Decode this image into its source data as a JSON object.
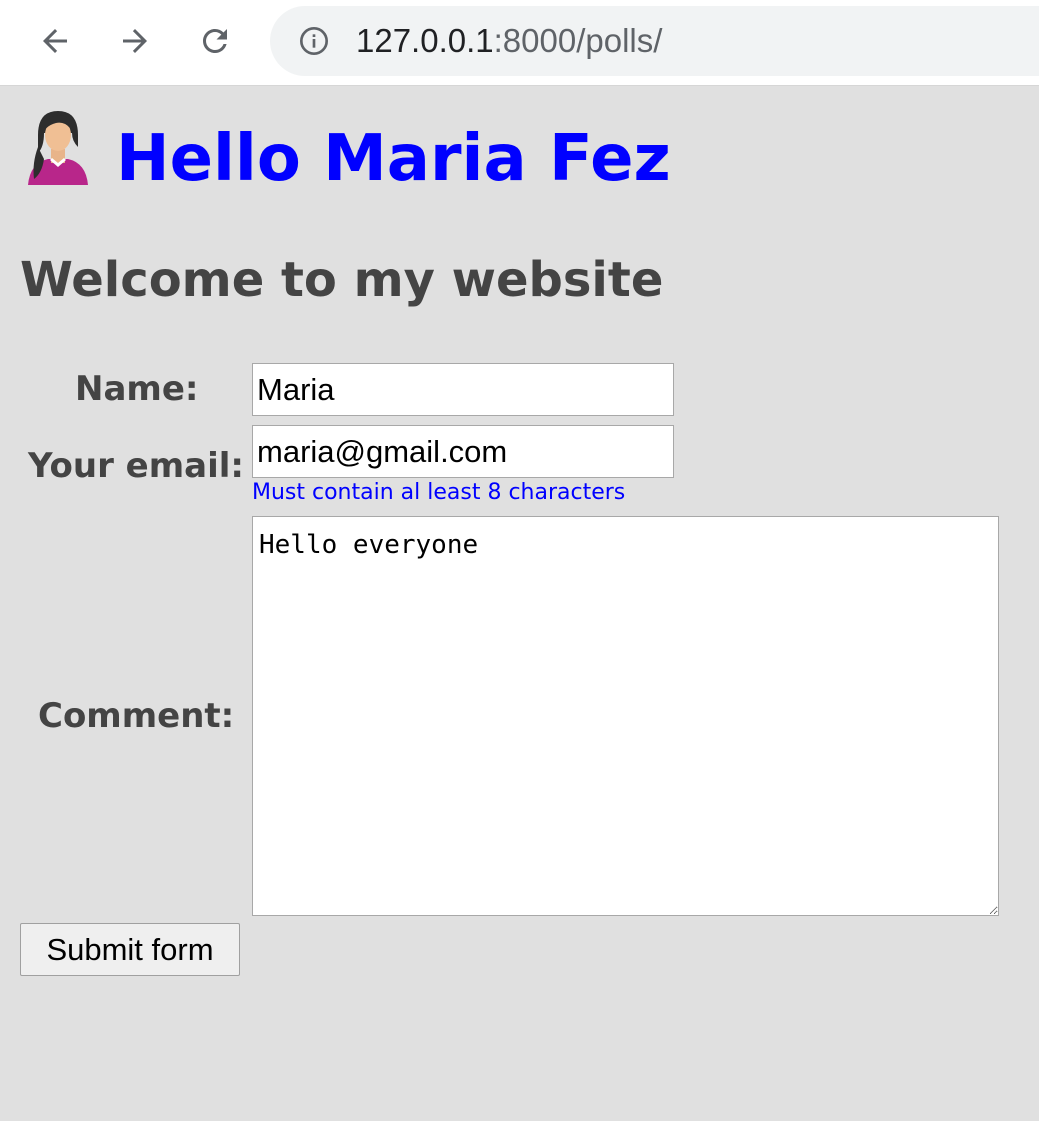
{
  "browser": {
    "url_host": "127.0.0.1",
    "url_rest": ":8000/polls/",
    "back_icon": "arrow-left-icon",
    "forward_icon": "arrow-right-icon",
    "reload_icon": "reload-icon",
    "site_info_icon": "info-icon"
  },
  "header": {
    "avatar_icon": "woman-avatar-icon",
    "greeting": "Hello Maria Fez",
    "greeting_color": "#0000ff"
  },
  "main": {
    "subtitle": "Welcome to my website"
  },
  "form": {
    "name_label": "Name:",
    "name_value": "Maria",
    "email_label": "Your email:",
    "email_value": "maria@gmail.com",
    "email_hint": "Must contain al least 8 characters",
    "comment_label": "Comment:",
    "comment_value": "Hello everyone",
    "submit_label": "Submit form"
  },
  "colors": {
    "page_background": "#e0e0e0",
    "label_text": "#444444",
    "hint_text": "#0000ff"
  }
}
